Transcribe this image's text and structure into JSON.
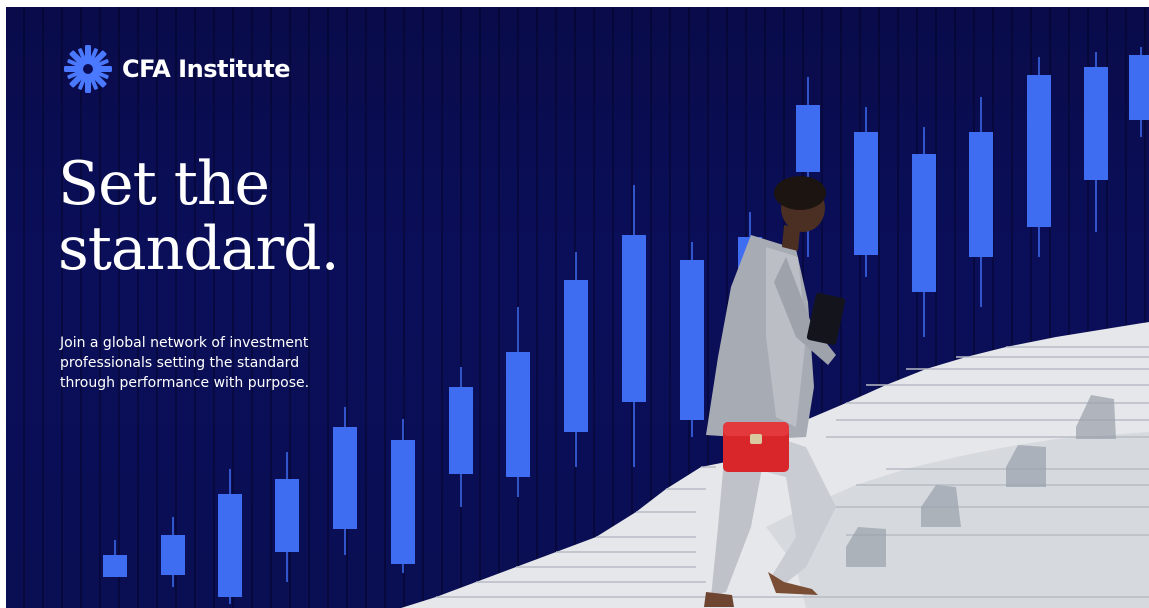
{
  "brand": {
    "name": "CFA Institute",
    "logo_icon": "cfa-globe-icon",
    "accent": "#3f6df2",
    "background": "#0a0d55"
  },
  "hero": {
    "headline_lines": [
      "Set the",
      "standard."
    ],
    "body_lines": [
      "Join a global network of investment",
      "professionals setting the standard",
      "through performance with purpose."
    ]
  },
  "illustration": {
    "motif": "candlestick-chart",
    "subject": "woman-climbing-stairs",
    "bag_color": "#d8262b"
  }
}
